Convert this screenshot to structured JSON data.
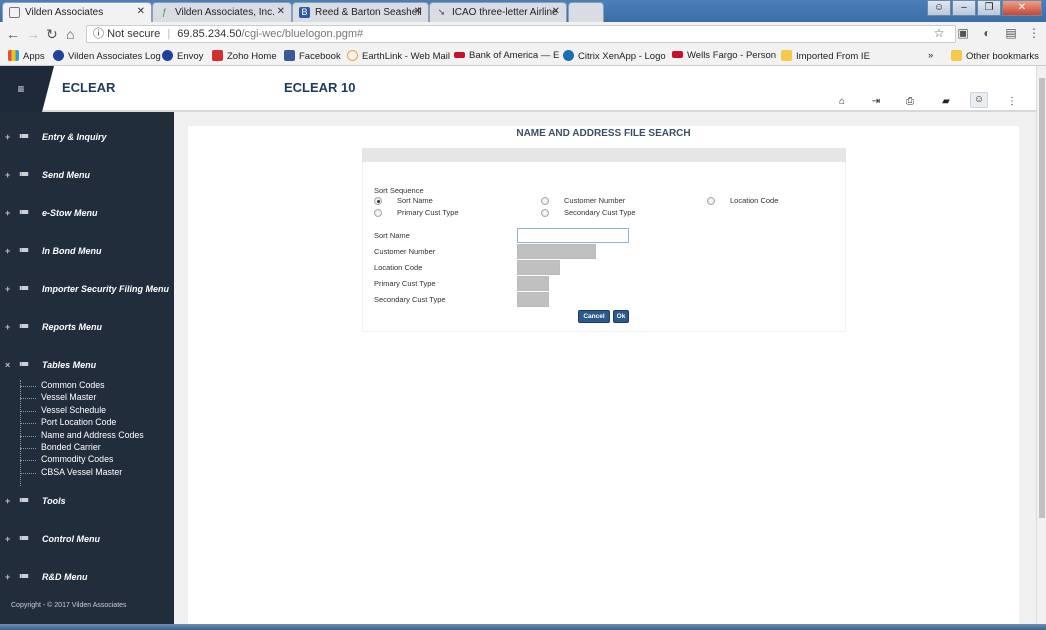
{
  "browser": {
    "tabs": [
      {
        "title": "Vilden Associates",
        "icon_color": "#ffffff"
      },
      {
        "title": "Vilden Associates, Inc.",
        "icon_color": "#3c9b3c"
      },
      {
        "title": "Reed & Barton Seashell",
        "icon_color": "#2c5aa0"
      },
      {
        "title": "ICAO three-letter Airline",
        "icon_color": "#444444"
      }
    ],
    "security": "Not secure",
    "url_host": "69.85.234.50",
    "url_path": "/cgi-wec/bluelogon.pgm#",
    "bookmarks": [
      {
        "label": "Apps",
        "color": "#e74c3c"
      },
      {
        "label": "Vilden Associates Log",
        "color": "#21429a"
      },
      {
        "label": "Envoy",
        "color": "#21429a"
      },
      {
        "label": "Zoho Home",
        "color": "#d32f2f"
      },
      {
        "label": "Facebook",
        "color": "#3b5998"
      },
      {
        "label": "EarthLink - Web Mail",
        "color": "#f3a530"
      },
      {
        "label": "Bank of America — E",
        "color": "#c8102e"
      },
      {
        "label": "Citrix XenApp - Logo",
        "color": "#1a6fb0"
      },
      {
        "label": "Wells Fargo - Person",
        "color": "#c8102e"
      },
      {
        "label": "Imported From IE",
        "color": "#f7c948"
      }
    ],
    "bookmarks_more": "»",
    "other_bookmarks": "Other bookmarks"
  },
  "app": {
    "brand": "ECLEAR",
    "version_title": "ECLEAR 10",
    "header_icons": [
      "home-icon",
      "sign-out-icon",
      "print-icon",
      "book-icon",
      "user-icon",
      "more-icon"
    ]
  },
  "sidebar": {
    "menus": [
      {
        "label": "Entry & Inquiry",
        "toggle": "+"
      },
      {
        "label": "Send Menu",
        "toggle": "+"
      },
      {
        "label": "e-Stow Menu",
        "toggle": "+"
      },
      {
        "label": "In Bond Menu",
        "toggle": "+"
      },
      {
        "label": "Importer Security Filing Menu",
        "toggle": "+"
      },
      {
        "label": "Reports Menu",
        "toggle": "+"
      },
      {
        "label": "Tables Menu",
        "toggle": "×"
      },
      {
        "label": "Tools",
        "toggle": "+"
      },
      {
        "label": "Control Menu",
        "toggle": "+"
      },
      {
        "label": "R&D Menu",
        "toggle": "+"
      }
    ],
    "tables_submenu": [
      "Common Codes",
      "Vessel Master",
      "Vessel Schedule",
      "Port Location Code",
      "Name and Address Codes",
      "Bonded Carrier",
      "Commodity Codes",
      "CBSA Vessel Master"
    ],
    "copyright": "Copyright - © 2017 Vilden Associates"
  },
  "search": {
    "title": "NAME AND ADDRESS FILE SEARCH",
    "sort_sequence_label": "Sort Sequence",
    "sort_options": {
      "sort_name": "Sort Name",
      "customer_number": "Customer Number",
      "location_code": "Location Code",
      "primary_cust_type": "Primary Cust Type",
      "secondary_cust_type": "Secondary Cust Type"
    },
    "selected_sort": "Sort Name",
    "fields": {
      "sort_name": {
        "label": "Sort Name",
        "value": ""
      },
      "customer_number": {
        "label": "Customer Number",
        "value": ""
      },
      "location_code": {
        "label": "Location Code",
        "value": ""
      },
      "primary_cust_type": {
        "label": "Primary Cust Type",
        "value": ""
      },
      "secondary_cust_type": {
        "label": "Secondary Cust Type",
        "value": ""
      }
    },
    "cancel_label": "Cancel",
    "ok_label": "Ok"
  }
}
